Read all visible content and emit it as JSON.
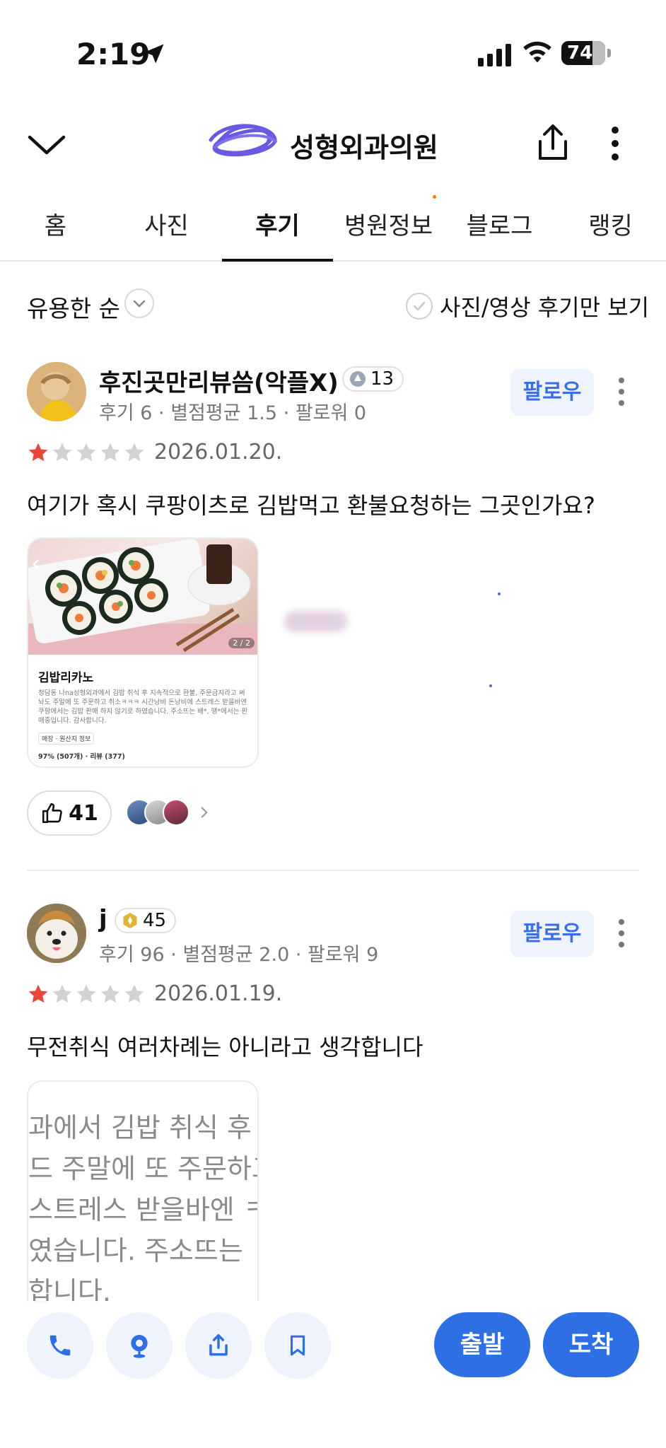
{
  "status_bar": {
    "time": "2:19",
    "battery": "74"
  },
  "header": {
    "title": "성형외과의원",
    "hidden_prefix": "(scribbled out)"
  },
  "tabs": [
    "홈",
    "사진",
    "후기",
    "병원정보",
    "블로그",
    "랭킹"
  ],
  "active_tab": "후기",
  "sort": {
    "label": "유용한 순",
    "photo_filter": "사진/영상 후기만 보기"
  },
  "reviews": [
    {
      "username": "후진곳만리뷰씀(악플X)",
      "badge_level": "13",
      "meta": "후기 6 · 별점평균 1.5 · 팔로워 0",
      "follow": "팔로우",
      "rating": 1,
      "date": "2026.01.20.",
      "text": "여기가 혹시 쿠팡이츠로 김밥먹고 환불요청하는 그곳인가요?",
      "card": {
        "page": "2 / 2",
        "title": "김밥리카노",
        "body": "청담동 나na성형외과에서 김밥 취식 후 지속적으로 환불, 주문금지라고 써놔도 주말에 또 주문하고 취소ㅋㅋㅋ 시간낭비 돈낭비에 스트레스 받을바엔 쿠팡에서는 김밥 판매 하지 않기로 하였습니다. 주소뜨는 배*, 땡*에서는 판매중입니다. 감사합니다.",
        "chip": "매장 · 원산지 정보",
        "stats": "97% (507개) · 리뷰 (377)"
      },
      "likes": "41"
    },
    {
      "username": "j",
      "badge_level": "45",
      "meta": "후기 96 · 별점평균 2.0 · 팔로워 9",
      "follow": "팔로우",
      "rating": 1,
      "date": "2026.01.19.",
      "text": "무전취식 여러차례는 아니라고 생각합니다",
      "card_lines": [
        "과에서 김밥 취식 후",
        "드 주말에 또 주문하고",
        "스트레스 받을바엔 ㅋ",
        "였습니다. 주소뜨는",
        "합니다."
      ]
    }
  ],
  "bottom": {
    "depart": "출발",
    "arrive": "도착"
  },
  "colors": {
    "accent": "#2f6fe4",
    "star_on": "#e8483c",
    "star_off": "#d2d2d2"
  }
}
